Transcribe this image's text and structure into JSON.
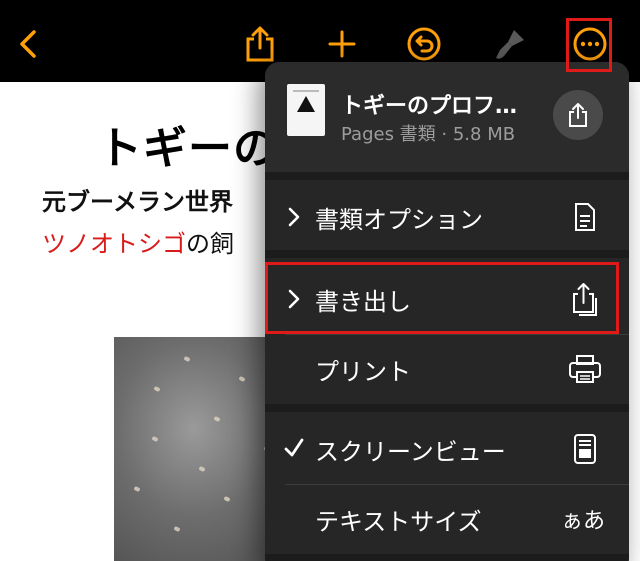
{
  "toolbar": {
    "icons": [
      "back-chevron-icon",
      "share-icon",
      "add-icon",
      "undo-icon",
      "brush-icon",
      "more-icon"
    ]
  },
  "document": {
    "title": "トギーの",
    "subtitle_line1": "元ブーメラン世界",
    "subtitle_line2_red": "ツノオトシゴ",
    "subtitle_line2_rest": "の飼"
  },
  "menu": {
    "file_name": "トギーのプロフ…",
    "file_meta": "Pages 書類 · 5.8 MB",
    "items": [
      {
        "label": "書類オプション",
        "icon": "document-icon"
      },
      {
        "label": "書き出し",
        "icon": "export-icon"
      },
      {
        "label": "プリント",
        "icon": "printer-icon"
      },
      {
        "label": "スクリーンビュー",
        "icon": "screen-view-icon"
      },
      {
        "label": "テキストサイズ",
        "icon_text": "ぁあ"
      }
    ]
  },
  "colors": {
    "accent": "#ff9f0a",
    "highlight": "#e01919",
    "menu_bg": "#262626",
    "red_text": "#d81b1b"
  }
}
